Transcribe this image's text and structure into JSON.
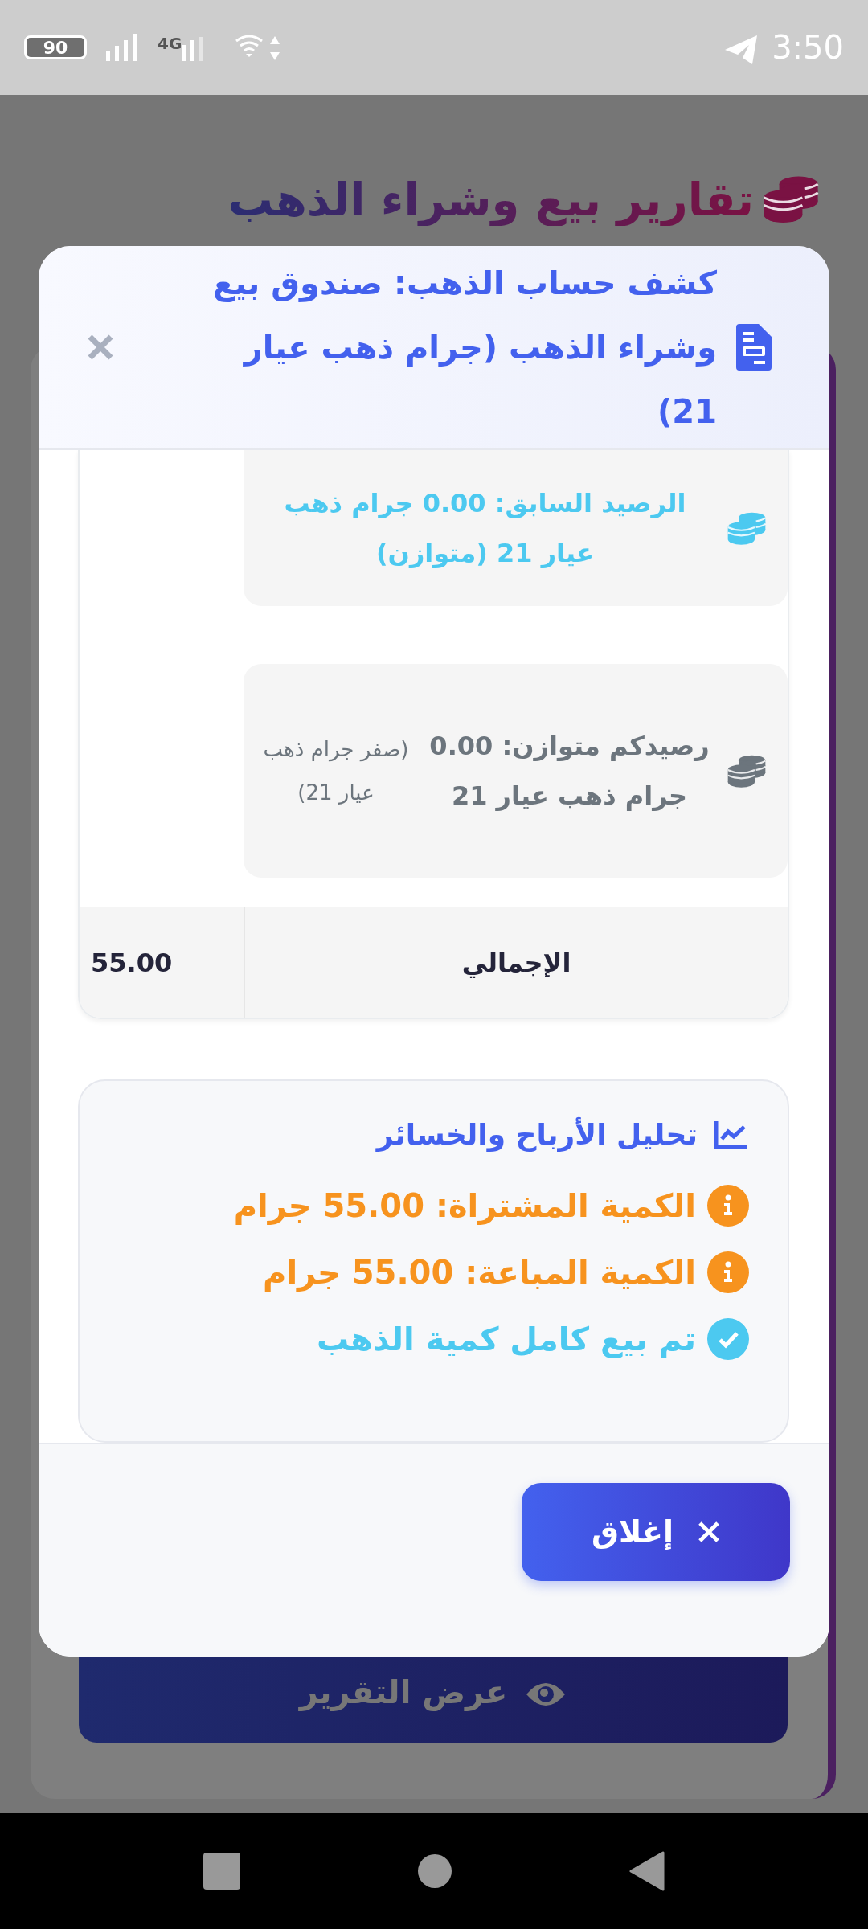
{
  "status_bar": {
    "battery": "90",
    "network": "4G",
    "time": "3:50"
  },
  "background": {
    "title": "تقارير بيع وشراء الذهب",
    "button": "عرض التقرير"
  },
  "dialog": {
    "title": "كشف حساب الذهب: صندوق بيع وشراء الذهب (جرام ذهب عيار 21)",
    "entries": [
      {
        "kind": "previous",
        "text": "الرصيد السابق: 0.00 جرام ذهب عيار 21 (متوازن)"
      },
      {
        "kind": "balance",
        "text": "رصيدكم متوازن: 0.00 جرام ذهب عيار 21",
        "note": "(صفر جرام ذهب عيار 21)"
      }
    ],
    "total": {
      "label": "الإجمالي",
      "value": "55.00"
    },
    "analysis": {
      "title": "تحليل الأرباح والخسائر",
      "items": [
        {
          "kind": "info",
          "text": "الكمية المشتراة: 55.00 جرام"
        },
        {
          "kind": "info",
          "text": "الكمية المباعة: 55.00 جرام"
        },
        {
          "kind": "success",
          "text": "تم بيع كامل كمية الذهب"
        }
      ]
    },
    "close_button": "إغلاق"
  }
}
